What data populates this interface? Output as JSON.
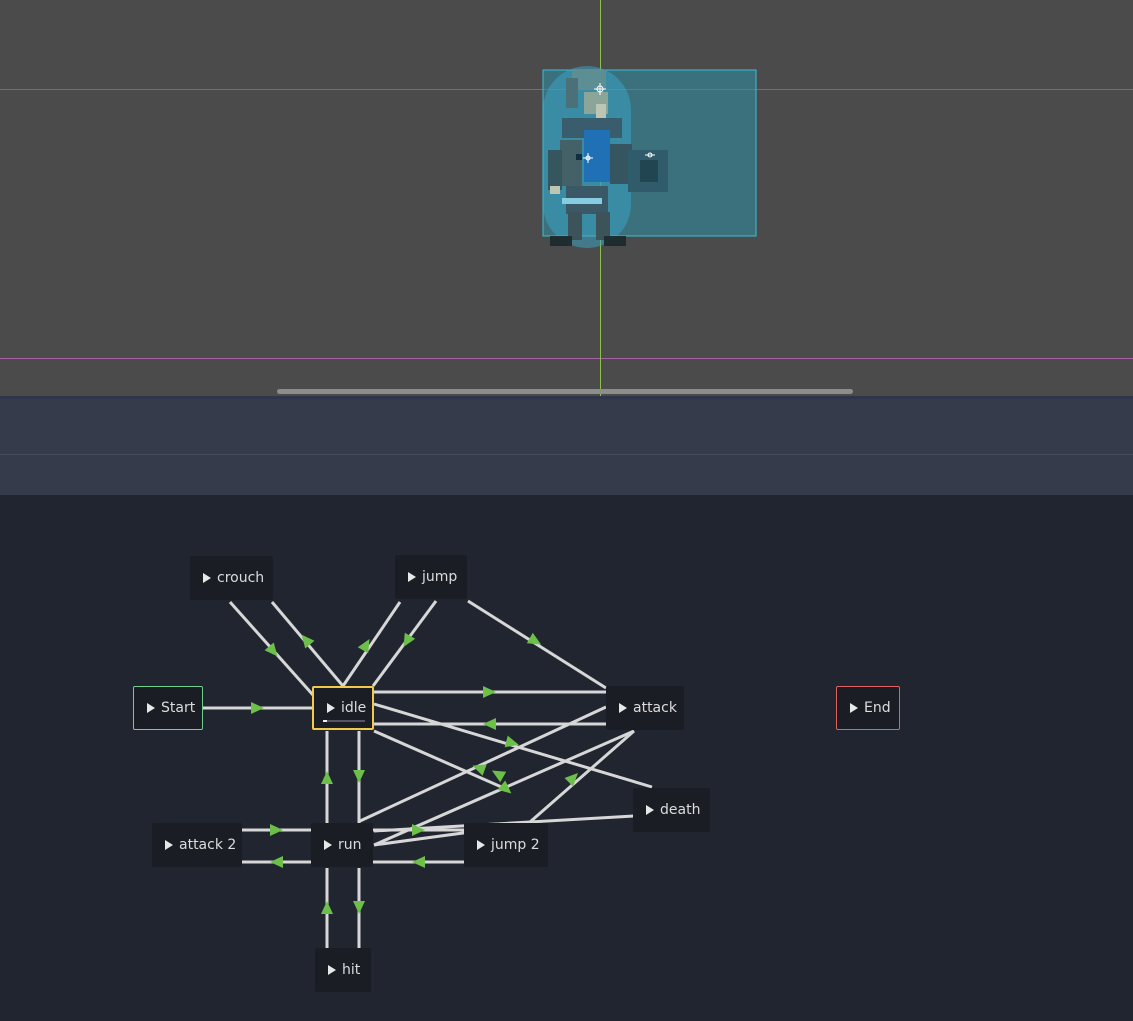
{
  "viewport": {
    "guides": {
      "horizontal_color": "#d04a6a",
      "vertical_color": "#9bc850",
      "lower_guide_color": "#b060b0"
    },
    "collision_color": "#2fa8c8"
  },
  "state_machine": {
    "nodes": {
      "start": "Start",
      "end": "End",
      "idle": "idle",
      "crouch": "crouch",
      "jump": "jump",
      "attack": "attack",
      "death": "death",
      "attack2": "attack 2",
      "run": "run",
      "jump2": "jump 2",
      "hit": "hit"
    },
    "selected": "idle",
    "idle_progress": 0.1,
    "colors": {
      "link": "#d7d7d7",
      "arrow": "#6cc04a",
      "selected_border": "#f2c94c",
      "start_border": "#6fcf8f",
      "end_border": "#e06060"
    }
  }
}
